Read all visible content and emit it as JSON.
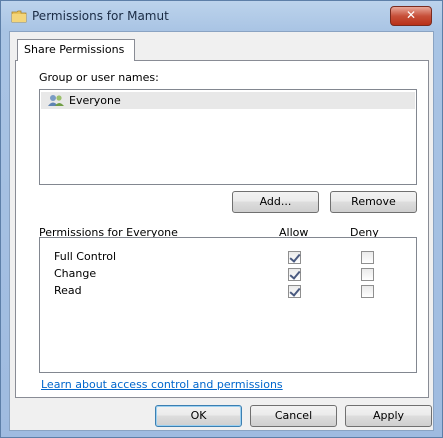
{
  "window": {
    "title": "Permissions for Mamut",
    "close_label": "✕"
  },
  "tabs": [
    {
      "label": "Share Permissions"
    }
  ],
  "groups": {
    "label": "Group or user names:",
    "items": [
      {
        "name": "Everyone"
      }
    ]
  },
  "buttons": {
    "add": "Add...",
    "remove": "Remove",
    "ok": "OK",
    "cancel": "Cancel",
    "apply": "Apply"
  },
  "permissions": {
    "header": "Permissions for Everyone",
    "allow_label": "Allow",
    "deny_label": "Deny",
    "rows": [
      {
        "name": "Full Control",
        "allow": true,
        "deny": false
      },
      {
        "name": "Change",
        "allow": true,
        "deny": false
      },
      {
        "name": "Read",
        "allow": true,
        "deny": false
      }
    ]
  },
  "link": "Learn about access control and permissions",
  "colors": {
    "link": "#0066cc",
    "close_button": "#c7503a",
    "title_bar": "#a9c4e4"
  }
}
